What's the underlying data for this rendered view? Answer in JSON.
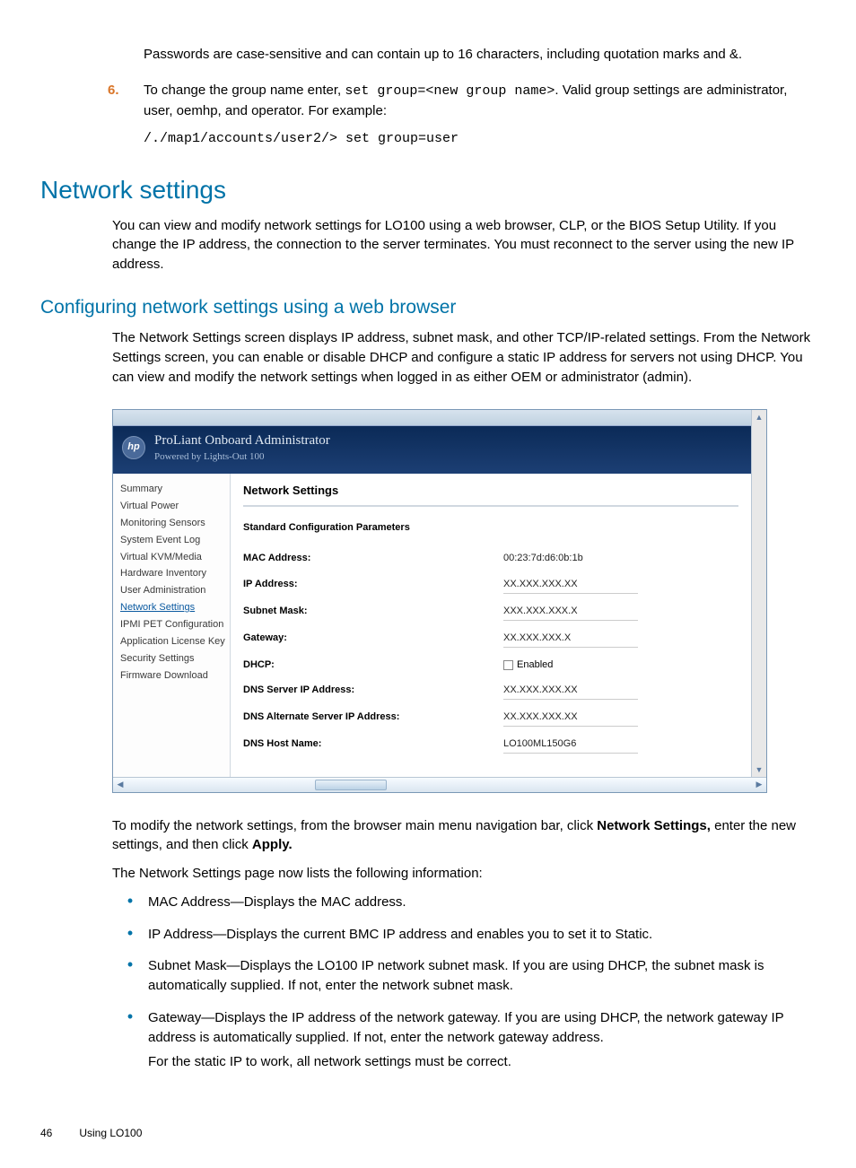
{
  "intro": {
    "pwnote": "Passwords are case-sensitive and can contain up to 16 characters, including quotation marks and &.",
    "step6num": "6.",
    "step6a": "To change the group name enter, ",
    "step6code": "set group=<new group name>",
    "step6b": ". Valid group settings are administrator, user, oemhp, and operator. For example:",
    "codeblock": "/./map1/accounts/user2/> set group=user"
  },
  "h1": "Network settings",
  "para1": "You can view and modify network settings for LO100 using a web browser, CLP, or the BIOS Setup Utility. If you change the IP address, the connection to the server terminates. You must reconnect to the server using the new IP address.",
  "h2": "Configuring network settings using a web browser",
  "para2": "The Network Settings screen displays IP address, subnet mask, and other TCP/IP-related settings. From the Network Settings screen, you can enable or disable DHCP and configure a static IP address for servers not using DHCP. You can view and modify the network settings when logged in as either OEM or administrator (admin).",
  "screenshot": {
    "logo": "hp",
    "bannerTitle": "ProLiant Onboard Administrator",
    "bannerSub": "Powered by Lights-Out 100",
    "sidebar": [
      "Summary",
      "Virtual Power",
      "Monitoring Sensors",
      "System Event Log",
      "Virtual KVM/Media",
      "Hardware Inventory",
      "User Administration",
      "Network Settings",
      "IPMI PET Configuration",
      "Application License Key",
      "Security Settings",
      "Firmware Download"
    ],
    "activeIndex": 7,
    "contentTitle": "Network Settings",
    "contentSubtitle": "Standard Configuration Parameters",
    "fields": [
      {
        "label": "MAC Address:",
        "value": "00:23:7d:d6:0b:1b",
        "plain": true
      },
      {
        "label": "IP Address:",
        "value": "XX.XXX.XXX.XX"
      },
      {
        "label": "Subnet Mask:",
        "value": "XXX.XXX.XXX.X"
      },
      {
        "label": "Gateway:",
        "value": "XX.XXX.XXX.X"
      },
      {
        "label": "DHCP:",
        "checkbox": true,
        "checkLabel": "Enabled"
      },
      {
        "label": "DNS Server IP Address:",
        "value": "XX.XXX.XXX.XX"
      },
      {
        "label": "DNS Alternate Server IP Address:",
        "value": "XX.XXX.XXX.XX"
      },
      {
        "label": "DNS Host Name:",
        "value": "LO100ML150G6"
      }
    ]
  },
  "after1a": "To modify the network settings, from the browser main menu navigation bar, click ",
  "after1bold": "Network Settings,",
  "after1b": " enter the new settings, and then click ",
  "after1bold2": "Apply.",
  "after2": "The Network Settings page now lists the following information:",
  "bullets": [
    {
      "text": "MAC Address—Displays the MAC address."
    },
    {
      "text": "IP Address—Displays the current BMC IP address and enables you to set it to Static."
    },
    {
      "text": "Subnet Mask—Displays the LO100 IP network subnet mask. If you are using DHCP, the subnet mask is automatically supplied. If not, enter the network subnet mask."
    },
    {
      "text": "Gateway—Displays the IP address of the network gateway. If you are using DHCP, the network gateway IP address is automatically supplied. If not, enter the network gateway address.",
      "sub": "For the static IP to work, all network settings must be correct."
    }
  ],
  "footer": {
    "page": "46",
    "section": "Using LO100"
  }
}
